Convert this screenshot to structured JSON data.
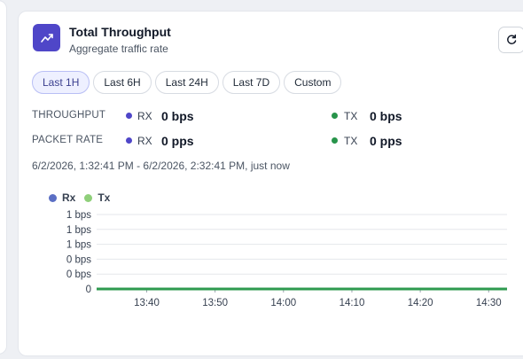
{
  "card": {
    "title": "Total Throughput",
    "subtitle": "Aggregate traffic rate",
    "icon": "trend-chart-icon",
    "accent": "#4f46c8"
  },
  "toolbar": {
    "refresh_icon": "refresh-icon"
  },
  "ranges": [
    {
      "label": "Last 1H",
      "active": true
    },
    {
      "label": "Last 6H",
      "active": false
    },
    {
      "label": "Last 24H",
      "active": false
    },
    {
      "label": "Last 7D",
      "active": false
    },
    {
      "label": "Custom",
      "active": false
    }
  ],
  "metrics": {
    "throughput": {
      "label": "THROUGHPUT",
      "rx_label": "RX",
      "rx_value": "0 bps",
      "tx_label": "TX",
      "tx_value": "0 bps"
    },
    "packet_rate": {
      "label": "PACKET RATE",
      "rx_label": "RX",
      "rx_value": "0 pps",
      "tx_label": "TX",
      "tx_value": "0 pps"
    }
  },
  "time_range_text": "6/2/2026, 1:32:41 PM - 6/2/2026, 2:32:41 PM, just now",
  "colors": {
    "rx": "#5b6fc4",
    "tx": "#8fcf7a",
    "tx_line": "#2e9a4f",
    "grid": "#e5e7eb"
  },
  "chart_data": {
    "type": "line",
    "legend": [
      "Rx",
      "Tx"
    ],
    "legend_placement": "top-left",
    "y_tick_labels": [
      "1 bps",
      "1 bps",
      "1 bps",
      "0 bps",
      "0 bps",
      "0"
    ],
    "x_tick_labels": [
      "13:40",
      "13:50",
      "14:00",
      "14:10",
      "14:20",
      "14:30"
    ],
    "x_range": [
      "13:32:41",
      "14:32:41"
    ],
    "ylim": [
      0,
      1
    ],
    "grid": true,
    "series": [
      {
        "name": "Rx",
        "x": [
          "13:32:41",
          "14:32:41"
        ],
        "values": [
          0,
          0
        ]
      },
      {
        "name": "Tx",
        "x": [
          "13:32:41",
          "14:32:41"
        ],
        "values": [
          0,
          0
        ]
      }
    ]
  }
}
